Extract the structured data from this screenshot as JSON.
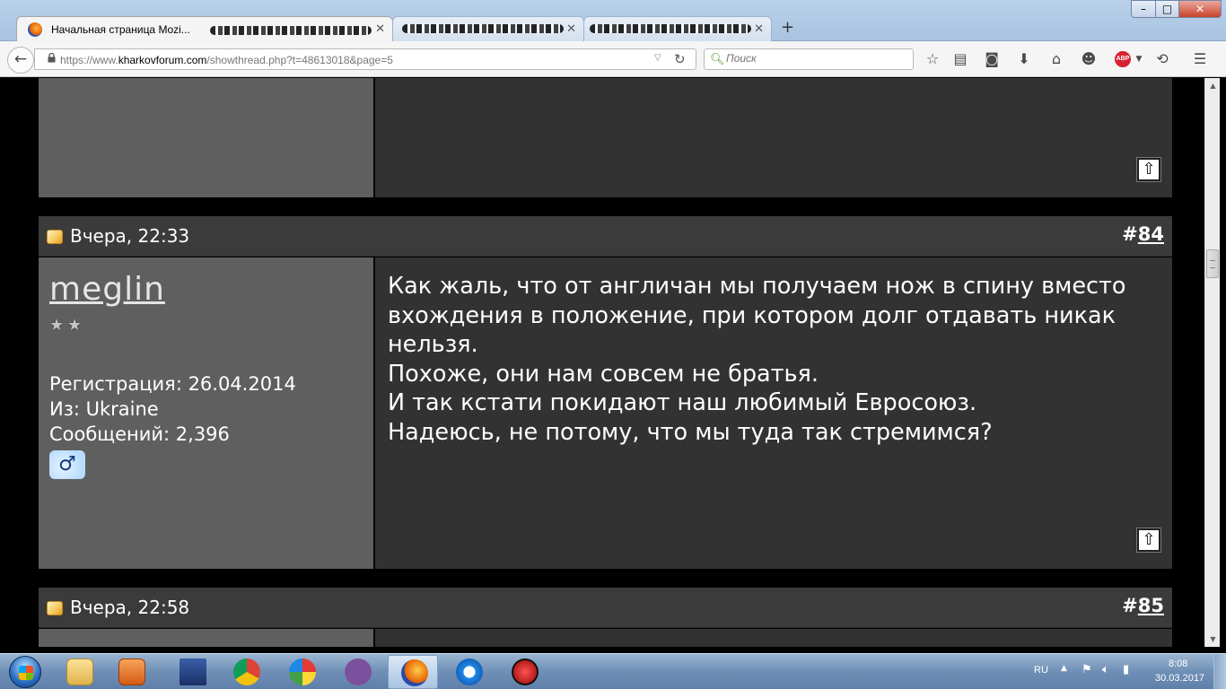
{
  "browser": {
    "tabs": [
      {
        "title": "Начальная страница Mozi...",
        "active": true
      },
      {
        "title": "",
        "active": false
      },
      {
        "title": "",
        "active": false
      }
    ],
    "new_tab_label": "+",
    "window_controls": {
      "minimize": "–",
      "maximize": "□",
      "close": "✕"
    },
    "url_prefix": "https://www.",
    "url_domain": "kharkovforum.com",
    "url_path": "/showthread.php?t=48613018&page=5",
    "search_placeholder": "Поиск",
    "abp_label": "ABP"
  },
  "posts": {
    "prev": {},
    "current": {
      "date": "Вчера, 22:33",
      "number_prefix": "#",
      "number": "84",
      "user": {
        "name": "meglin",
        "stars": 2,
        "registration": "Регистрация: 26.04.2014",
        "location": "Из: Ukraine",
        "messages": "Сообщений: 2,396"
      },
      "text_lines": [
        "Как жаль, что от англичан мы получаем нож в спину вместо",
        "вхождения в положение, при котором долг отдавать никак",
        "нельзя.",
        "Похоже, они нам совсем не братья.",
        "И так кстати покидают наш любимый Евросоюз.",
        "Надеюсь, не потому, что мы туда так стремимся?"
      ]
    },
    "next": {
      "date": "Вчера, 22:58",
      "number_prefix": "#",
      "number": "85"
    }
  },
  "taskbar": {
    "language": "RU",
    "time": "8:08",
    "date": "30.03.2017"
  }
}
